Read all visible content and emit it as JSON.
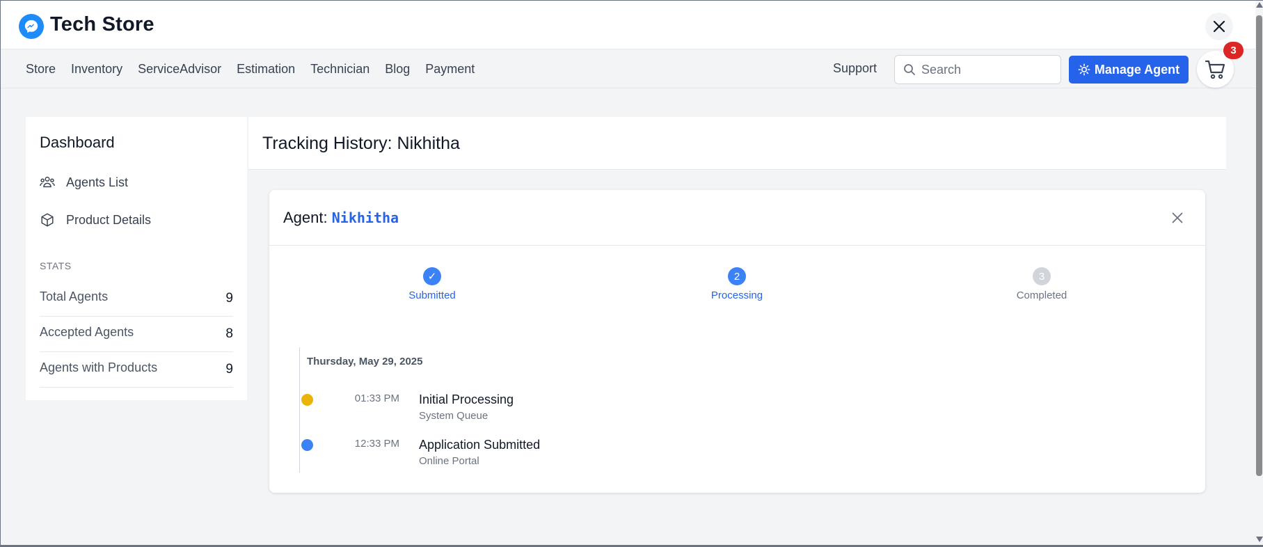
{
  "brand": {
    "title": "Tech Store",
    "color": "#1d8cf8"
  },
  "nav": {
    "links": [
      "Store",
      "Inventory",
      "ServiceAdvisor",
      "Estimation",
      "Technician",
      "Blog",
      "Payment"
    ],
    "support": "Support",
    "search_placeholder": "Search",
    "manage_label": "Manage Agent",
    "cart_count": "3"
  },
  "sidebar": {
    "title": "Dashboard",
    "items": [
      {
        "label": "Agents List",
        "icon": "users-icon"
      },
      {
        "label": "Product Details",
        "icon": "cube-icon"
      }
    ],
    "stats_label": "STATS",
    "stats": [
      {
        "label": "Total Agents",
        "value": "9"
      },
      {
        "label": "Accepted Agents",
        "value": "8"
      },
      {
        "label": "Agents with Products",
        "value": "9"
      }
    ]
  },
  "main": {
    "title": "Tracking History: Nikhitha",
    "agent_prefix": "Agent:",
    "agent_name": "Nikhitha",
    "steps": [
      {
        "marker": "✓",
        "label": "Submitted",
        "state": "done"
      },
      {
        "marker": "2",
        "label": "Processing",
        "state": "active"
      },
      {
        "marker": "3",
        "label": "Completed",
        "state": "pending"
      }
    ],
    "timeline": {
      "date": "Thursday, May 29, 2025",
      "events": [
        {
          "time": "01:33 PM",
          "title": "Initial Processing",
          "source": "System Queue",
          "color": "#eab308"
        },
        {
          "time": "12:33 PM",
          "title": "Application Submitted",
          "source": "Online Portal",
          "color": "#3b82f6"
        }
      ]
    }
  },
  "colors": {
    "accent": "#2563eb",
    "badge": "#dc2626",
    "pending": "#d1d5db"
  }
}
